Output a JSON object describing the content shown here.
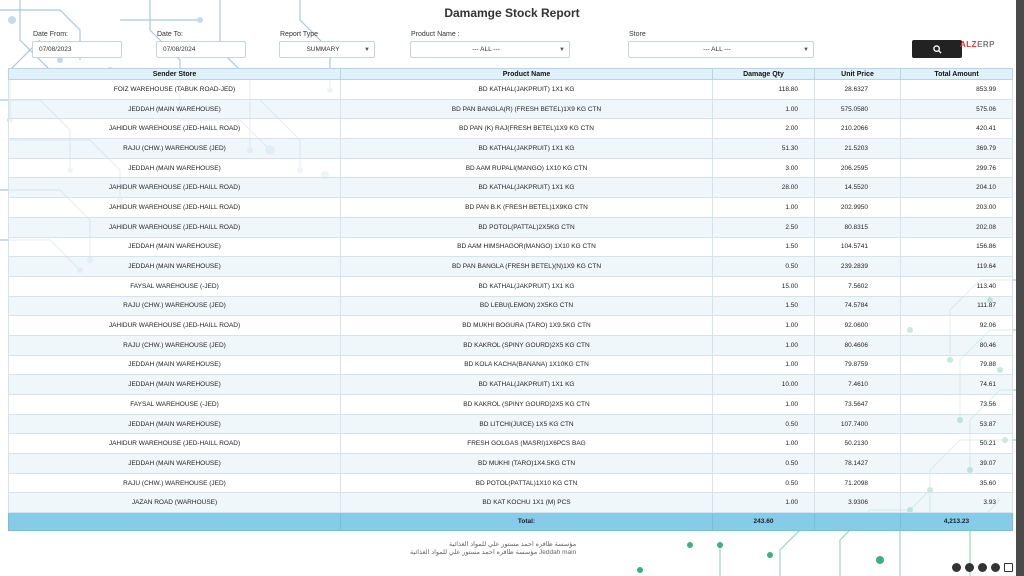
{
  "report": {
    "title": "Damamge Stock Report"
  },
  "filters": {
    "date_from": {
      "label": "Date From:",
      "value": "07/08/2023"
    },
    "date_to": {
      "label": "Date To:",
      "value": "07/08/2024"
    },
    "report_type": {
      "label": "Report Type",
      "value": "SUMMARY"
    },
    "product_name": {
      "label": "Product Name :",
      "value": "--- ALL ---"
    },
    "store": {
      "label": "Store",
      "value": "--- ALL ---"
    }
  },
  "logo": {
    "brand": "ALZ",
    "suffix": "ERP"
  },
  "table": {
    "headers": [
      "Sender Store",
      "Product Name",
      "Damage Qty",
      "Unit Price",
      "Total Amount"
    ],
    "rows": [
      [
        "FOIZ WAREHOUSE (TABUK ROAD-JED)",
        "BD KATHAL(JAKPRUIT) 1X1 KG",
        "118.80",
        "28.6327",
        "853.99"
      ],
      [
        "JEDDAH (MAIN WAREHOUSE)",
        "BD PAN BANGLA(R) (FRESH BETEL)1X9 KG CTN",
        "1.00",
        "575.0580",
        "575.06"
      ],
      [
        "JAHIDUR WAREHOUSE (JED-HAILL ROAD)",
        "BD PAN (K) RAJ(FRESH BETEL)1X9 KG CTN",
        "2.00",
        "210.2066",
        "420.41"
      ],
      [
        "RAJU (CHW.) WAREHOUSE (JED)",
        "BD KATHAL(JAKPRUIT) 1X1 KG",
        "51.30",
        "21.5203",
        "369.79"
      ],
      [
        "JEDDAH (MAIN WAREHOUSE)",
        "BD AAM RUPALI(MANGO) 1X10 KG CTN",
        "3.00",
        "206.2595",
        "299.76"
      ],
      [
        "JAHIDUR WAREHOUSE (JED-HAILL ROAD)",
        "BD KATHAL(JAKPRUIT) 1X1 KG",
        "28.00",
        "14.5520",
        "204.10"
      ],
      [
        "JAHIDUR WAREHOUSE (JED-HAILL ROAD)",
        "BD PAN B.K (FRESH BETEL)1X9KG CTN",
        "1.00",
        "202.9950",
        "203.00"
      ],
      [
        "JAHIDUR WAREHOUSE (JED-HAILL ROAD)",
        "BD POTOL(PATTAL)2X5KG CTN",
        "2.50",
        "80.8315",
        "202.08"
      ],
      [
        "JEDDAH (MAIN WAREHOUSE)",
        "BD AAM HIMSHAGOR(MANGO) 1X10 KG CTN",
        "1.50",
        "104.5741",
        "156.86"
      ],
      [
        "JEDDAH (MAIN WAREHOUSE)",
        "BD PAN BANGLA (FRESH BETEL)(N)1X9 KG CTN",
        "0.50",
        "239.2839",
        "119.64"
      ],
      [
        "FAYSAL WAREHOUSE (-JED)",
        "BD KATHAL(JAKPRUIT) 1X1 KG",
        "15.00",
        "7.5602",
        "113.40"
      ],
      [
        "RAJU (CHW.) WAREHOUSE (JED)",
        "BD LEBU(LEMON) 2X5KG CTN",
        "1.50",
        "74.5784",
        "111.87"
      ],
      [
        "JAHIDUR WAREHOUSE (JED-HAILL ROAD)",
        "BD MUKHI BOGURA (TARO) 1X9.5KG CTN",
        "1.00",
        "92.0600",
        "92.06"
      ],
      [
        "RAJU (CHW.) WAREHOUSE (JED)",
        "BD KAKROL (SPINY GOURD)2X5 KG CTN",
        "1.00",
        "80.4606",
        "80.46"
      ],
      [
        "JEDDAH (MAIN WAREHOUSE)",
        "BD KOLA KACHA(BANANA) 1X10KG CTN",
        "1.00",
        "79.8759",
        "79.88"
      ],
      [
        "JEDDAH (MAIN WAREHOUSE)",
        "BD KATHAL(JAKPRUIT) 1X1 KG",
        "10.00",
        "7.4610",
        "74.61"
      ],
      [
        "FAYSAL WAREHOUSE (-JED)",
        "BD KAKROL (SPINY GOURD)2X5 KG CTN",
        "1.00",
        "73.5647",
        "73.56"
      ],
      [
        "JEDDAH (MAIN WAREHOUSE)",
        "BD LITCHI(JUICE) 1X5 KG CTN",
        "0.50",
        "107.7400",
        "53.87"
      ],
      [
        "JAHIDUR WAREHOUSE (JED-HAILL ROAD)",
        "FRESH GOLGAS (MASRI)1X6PCS BAG",
        "1.00",
        "50.2130",
        "50.21"
      ],
      [
        "JEDDAH (MAIN WAREHOUSE)",
        "BD MUKHI (TARO)1X4.5KG CTN",
        "0.50",
        "78.1427",
        "39.07"
      ],
      [
        "RAJU (CHW.) WAREHOUSE (JED)",
        "BD POTOL(PATTAL)1X10 KG CTN",
        "0.50",
        "71.2098",
        "35.60"
      ],
      [
        "JAZAN ROAD (WARHOUSE)",
        "BD KAT KOCHU 1X1 (M) PCS",
        "1.00",
        "3.9306",
        "3.93"
      ]
    ],
    "total": {
      "label": "Total:",
      "qty": "243.60",
      "amount": "4,213.23"
    }
  },
  "footer": {
    "line1": "مؤسسة ظافره احمد مستور علي للمواد الغذائية",
    "line2": "مؤسسة ظافره احمد مستور علي للمواد الغذائية Jeddah main"
  }
}
